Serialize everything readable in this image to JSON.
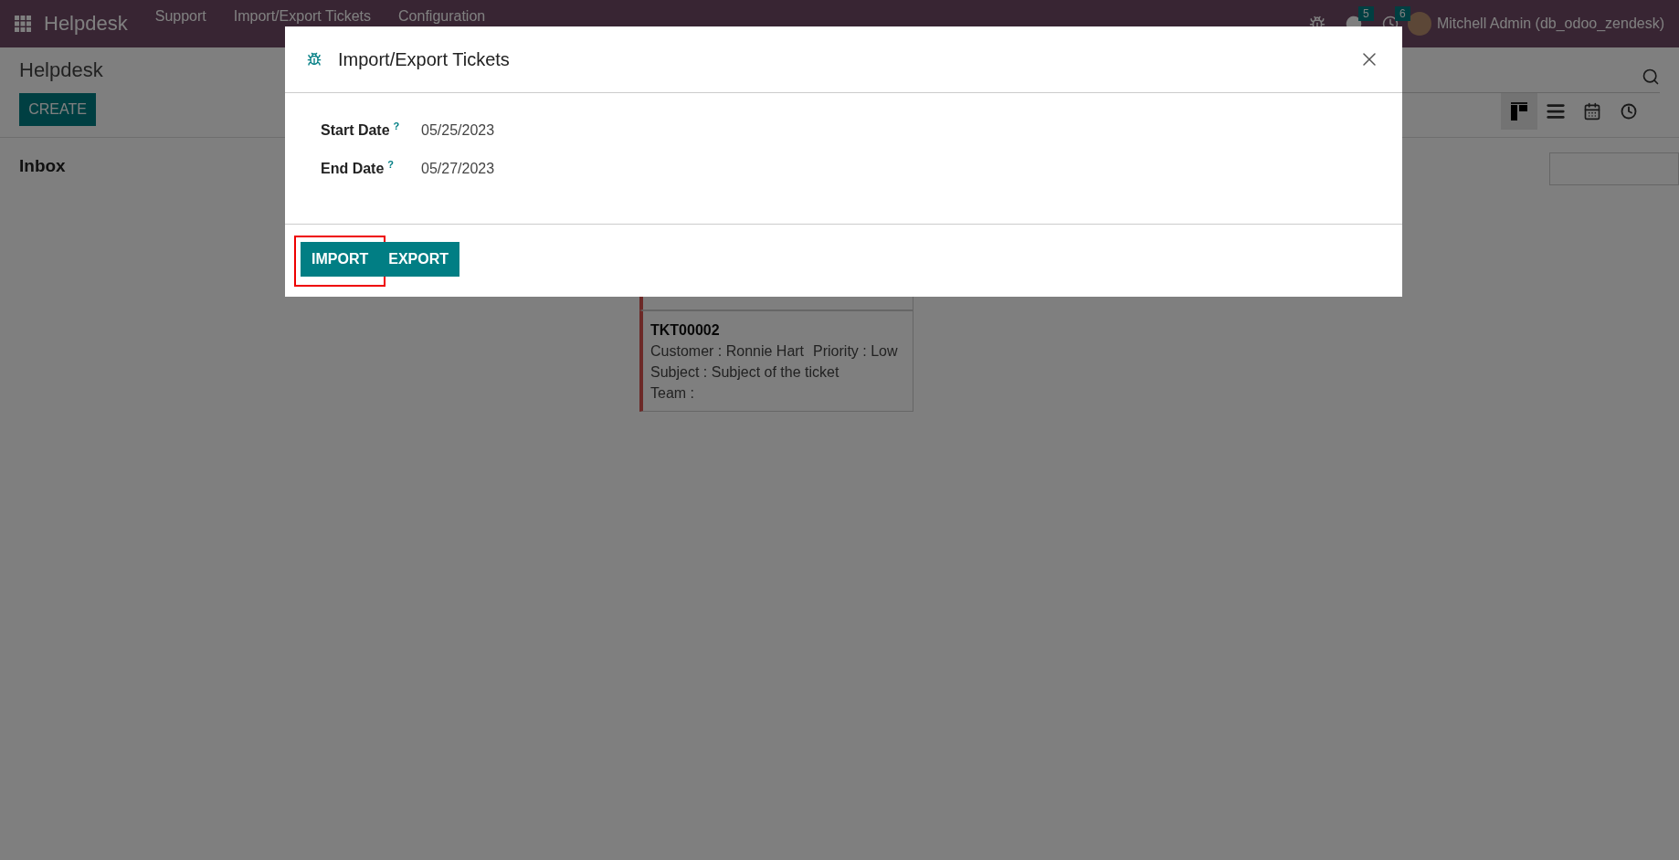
{
  "navbar": {
    "app_name": "Helpdesk",
    "menus": [
      "Support",
      "Import/Export Tickets",
      "Configuration"
    ],
    "messages_count": "5",
    "activities_count": "6",
    "user": "Mitchell Admin (db_odoo_zendesk)"
  },
  "control_panel": {
    "breadcrumb": "Helpdesk",
    "create_label": "CREATE",
    "views": [
      {
        "kind": "kanban",
        "selected": true
      },
      {
        "kind": "list",
        "selected": false
      },
      {
        "kind": "calendar",
        "selected": false
      },
      {
        "kind": "activity",
        "selected": false
      }
    ]
  },
  "column": {
    "title": "Inbox"
  },
  "cards": [
    {
      "ref": "TKT00002",
      "customer": "Customer : Ronnie Hart",
      "priority": "Priority : Low",
      "subject": "Subject : Subject of the ticket",
      "team": "Team :"
    }
  ],
  "dialog": {
    "title": "Import/Export Tickets",
    "fields": [
      {
        "label": "Start Date",
        "help": "?",
        "value": "05/25/2023"
      },
      {
        "label": "End Date",
        "help": "?",
        "value": "05/27/2023"
      }
    ],
    "buttons": [
      {
        "label": "IMPORT",
        "highlighted": true
      },
      {
        "label": "EXPORT",
        "highlighted": false
      }
    ]
  }
}
